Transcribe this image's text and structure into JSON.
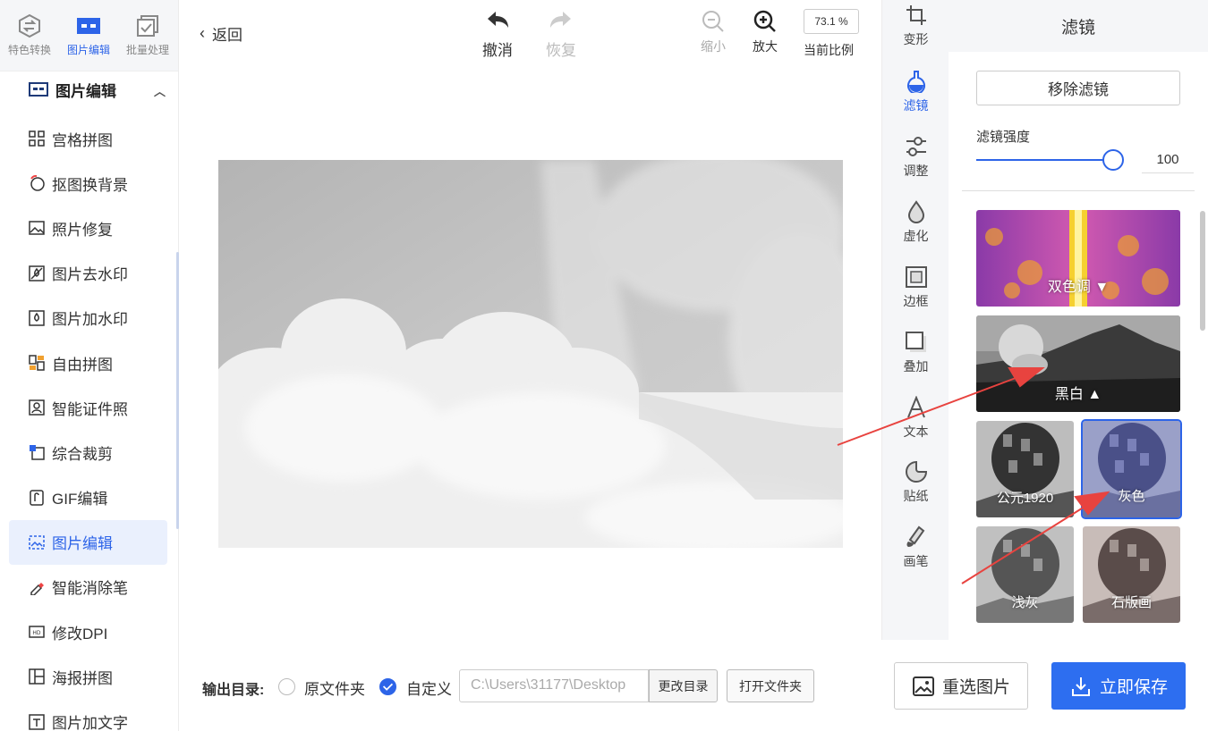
{
  "topnav": [
    {
      "label": "特色转换",
      "icon": "swap-icon"
    },
    {
      "label": "图片编辑",
      "icon": "image-edit-icon"
    },
    {
      "label": "批量处理",
      "icon": "batch-icon"
    }
  ],
  "section": {
    "title": "图片编辑"
  },
  "menu": [
    {
      "label": "宫格拼图",
      "icon": "grid-icon"
    },
    {
      "label": "抠图换背景",
      "icon": "cutout-icon"
    },
    {
      "label": "照片修复",
      "icon": "photo-icon"
    },
    {
      "label": "图片去水印",
      "icon": "remove-watermark-icon"
    },
    {
      "label": "图片加水印",
      "icon": "add-watermark-icon"
    },
    {
      "label": "自由拼图",
      "icon": "collage-icon"
    },
    {
      "label": "智能证件照",
      "icon": "id-photo-icon"
    },
    {
      "label": "综合裁剪",
      "icon": "crop-icon"
    },
    {
      "label": "GIF编辑",
      "icon": "gif-icon"
    },
    {
      "label": "图片编辑",
      "icon": "image-edit-icon"
    },
    {
      "label": "智能消除笔",
      "icon": "eraser-pen-icon"
    },
    {
      "label": "修改DPI",
      "icon": "dpi-icon"
    },
    {
      "label": "海报拼图",
      "icon": "poster-icon"
    },
    {
      "label": "图片加文字",
      "icon": "add-text-icon"
    }
  ],
  "topbar": {
    "back": "返回",
    "undo": "撤消",
    "redo": "恢复",
    "zoom_out": "缩小",
    "zoom_in": "放大",
    "zoom_value": "73.1 %",
    "zoom_label": "当前比例"
  },
  "output": {
    "label": "输出目录:",
    "option_original": "原文件夹",
    "option_custom": "自定义",
    "path": "C:\\Users\\31177\\Desktop",
    "change_dir": "更改目录",
    "open_folder": "打开文件夹"
  },
  "tools": [
    {
      "label": "变形",
      "icon": "transform-icon"
    },
    {
      "label": "滤镜",
      "icon": "filter-flask-icon"
    },
    {
      "label": "调整",
      "icon": "adjust-icon"
    },
    {
      "label": "虚化",
      "icon": "blur-drop-icon"
    },
    {
      "label": "边框",
      "icon": "frame-icon"
    },
    {
      "label": "叠加",
      "icon": "overlay-icon"
    },
    {
      "label": "文本",
      "icon": "text-icon"
    },
    {
      "label": "贴纸",
      "icon": "sticker-icon"
    },
    {
      "label": "画笔",
      "icon": "brush-icon"
    }
  ],
  "panel": {
    "title": "滤镜",
    "remove_filter": "移除滤镜",
    "strength_label": "滤镜强度",
    "strength_value": "100",
    "strength_level": 1.0,
    "filters": [
      {
        "label": "双色调"
      },
      {
        "label": "黑白"
      },
      {
        "label": "公元1920"
      },
      {
        "label": "灰色"
      },
      {
        "label": "浅灰"
      },
      {
        "label": "石版画"
      }
    ]
  },
  "actions": {
    "reselect": "重选图片",
    "save": "立即保存"
  },
  "colors": {
    "accent": "#2d64e8",
    "save_button": "#2d6ef0",
    "annotation_arrow": "#e8433f"
  }
}
